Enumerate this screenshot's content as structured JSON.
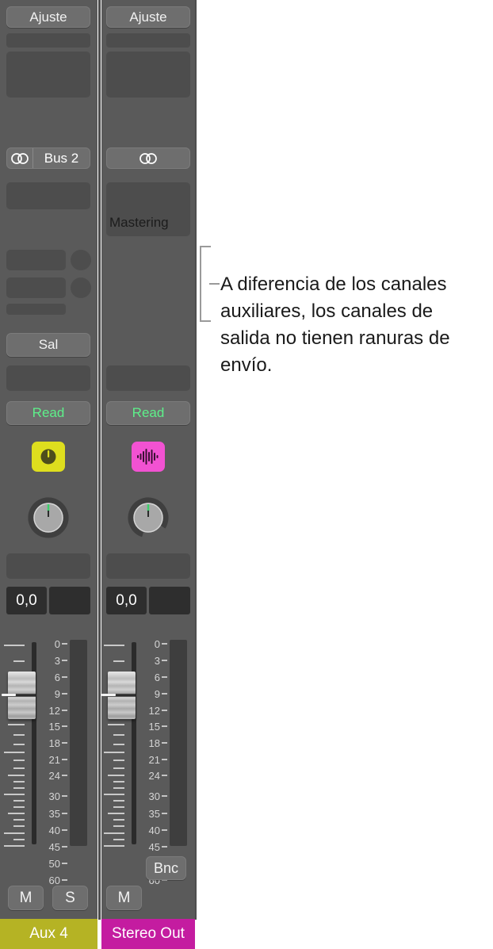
{
  "mixer": {
    "channels": [
      {
        "id": "aux-4",
        "settings_label": "Ajuste",
        "io_label": "Bus 2",
        "io_icon": "stereo-icon",
        "insert_label": "",
        "output_label": "Sal",
        "automation_label": "Read",
        "plugin_icon": "knob-plugin-icon",
        "plugin_color": "#dede1e",
        "volume_value": "0,0",
        "pan_value": "",
        "mute_label": "M",
        "solo_label": "S",
        "bounce_label": "",
        "name": "Aux 4",
        "name_color": "#b5b324",
        "has_sends": true,
        "has_solo": true,
        "has_bounce": false
      },
      {
        "id": "stereo-out",
        "settings_label": "Ajuste",
        "io_label": "",
        "io_icon": "stereo-icon",
        "insert_label": "Mastering",
        "output_label": "",
        "automation_label": "Read",
        "plugin_icon": "waveform-plugin-icon",
        "plugin_color": "#f252d2",
        "volume_value": "0,0",
        "pan_value": "",
        "mute_label": "M",
        "solo_label": "",
        "bounce_label": "Bnc",
        "name": "Stereo Out",
        "name_color": "#c41ca0",
        "has_sends": false,
        "has_solo": false,
        "has_bounce": true
      }
    ],
    "fader_scale": [
      "0",
      "3",
      "6",
      "9",
      "12",
      "15",
      "18",
      "21",
      "24",
      "30",
      "35",
      "40",
      "45",
      "50",
      "60"
    ],
    "automation_text_color": "#5ef08a"
  },
  "callout": {
    "text": "A diferencia de los canales auxiliares, los canales de salida no tienen ranuras de envío."
  }
}
